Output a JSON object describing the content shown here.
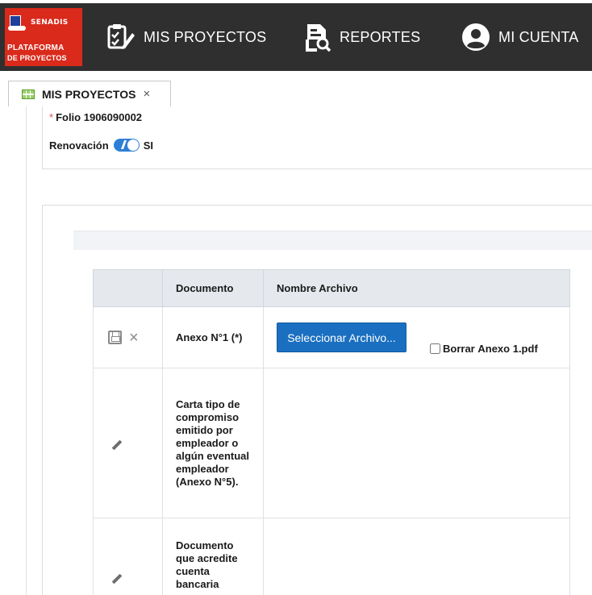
{
  "logo": {
    "org": "SENADIS",
    "line1": "PLATAFORMA",
    "line2": "DE PROYECTOS"
  },
  "nav": {
    "items": [
      {
        "label": "MIS PROYECTOS",
        "icon": "clipboard-edit-icon"
      },
      {
        "label": "REPORTES",
        "icon": "report-search-icon"
      },
      {
        "label": "MI CUENTA",
        "icon": "user-circle-icon"
      }
    ]
  },
  "tabs": [
    {
      "label": "MIS PROYECTOS",
      "icon": "grid-icon",
      "close": "×"
    }
  ],
  "folio": {
    "required_mark": "*",
    "label": "Folio",
    "value": "1906090002"
  },
  "renovacion": {
    "label": "Renovación",
    "value": "SI",
    "on": true
  },
  "documents": {
    "columns": [
      "",
      "Documento",
      "Nombre Archivo"
    ],
    "rows": [
      {
        "documento": "Anexo N°1 (*)",
        "button_label": "Seleccionar Archivo...",
        "delete_label": "Borrar",
        "file_name": "Anexo 1.pdf",
        "editing": true
      },
      {
        "documento": "Carta tipo de compromiso emitido por empleador o algún eventual empleador (Anexo N°5).",
        "editing": false
      },
      {
        "documento": "Documento que acredite cuenta bancaria",
        "editing": false
      }
    ]
  },
  "colors": {
    "topbar": "#2f2f30",
    "logo_red": "#d92a1c",
    "button_blue": "#1a6fc0",
    "toggle_blue": "#2d7fd6",
    "table_header": "#e5e9ee"
  }
}
